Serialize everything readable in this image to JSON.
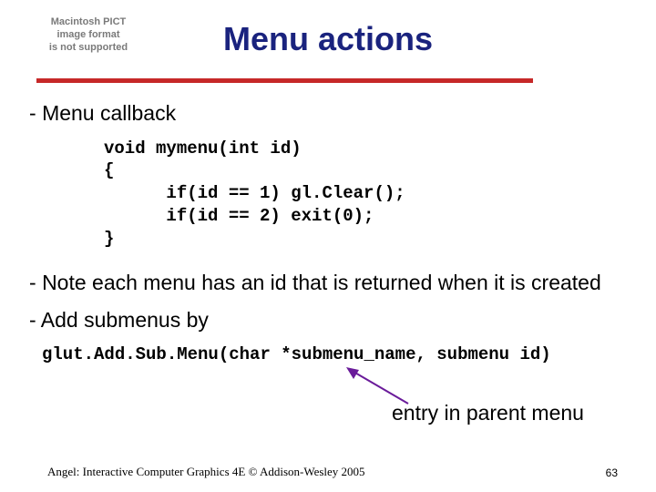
{
  "placeholder": {
    "l1": "Macintosh PICT",
    "l2": "image format",
    "l3": "is not supported"
  },
  "title": "Menu actions",
  "bullets": {
    "b1": "Menu callback",
    "b2": "Note each menu has an id that is returned when it is created",
    "b3": "Add submenus by"
  },
  "code1": "void mymenu(int id)\n{\n      if(id == 1) gl.Clear();\n      if(id == 2) exit(0);\n}",
  "code2": "glut.Add.Sub.Menu(char *submenu_name, submenu id)",
  "annotation": "entry in parent menu",
  "footer": {
    "left": "Angel: Interactive Computer Graphics 4E © Addison-Wesley 2005",
    "right": "63"
  }
}
